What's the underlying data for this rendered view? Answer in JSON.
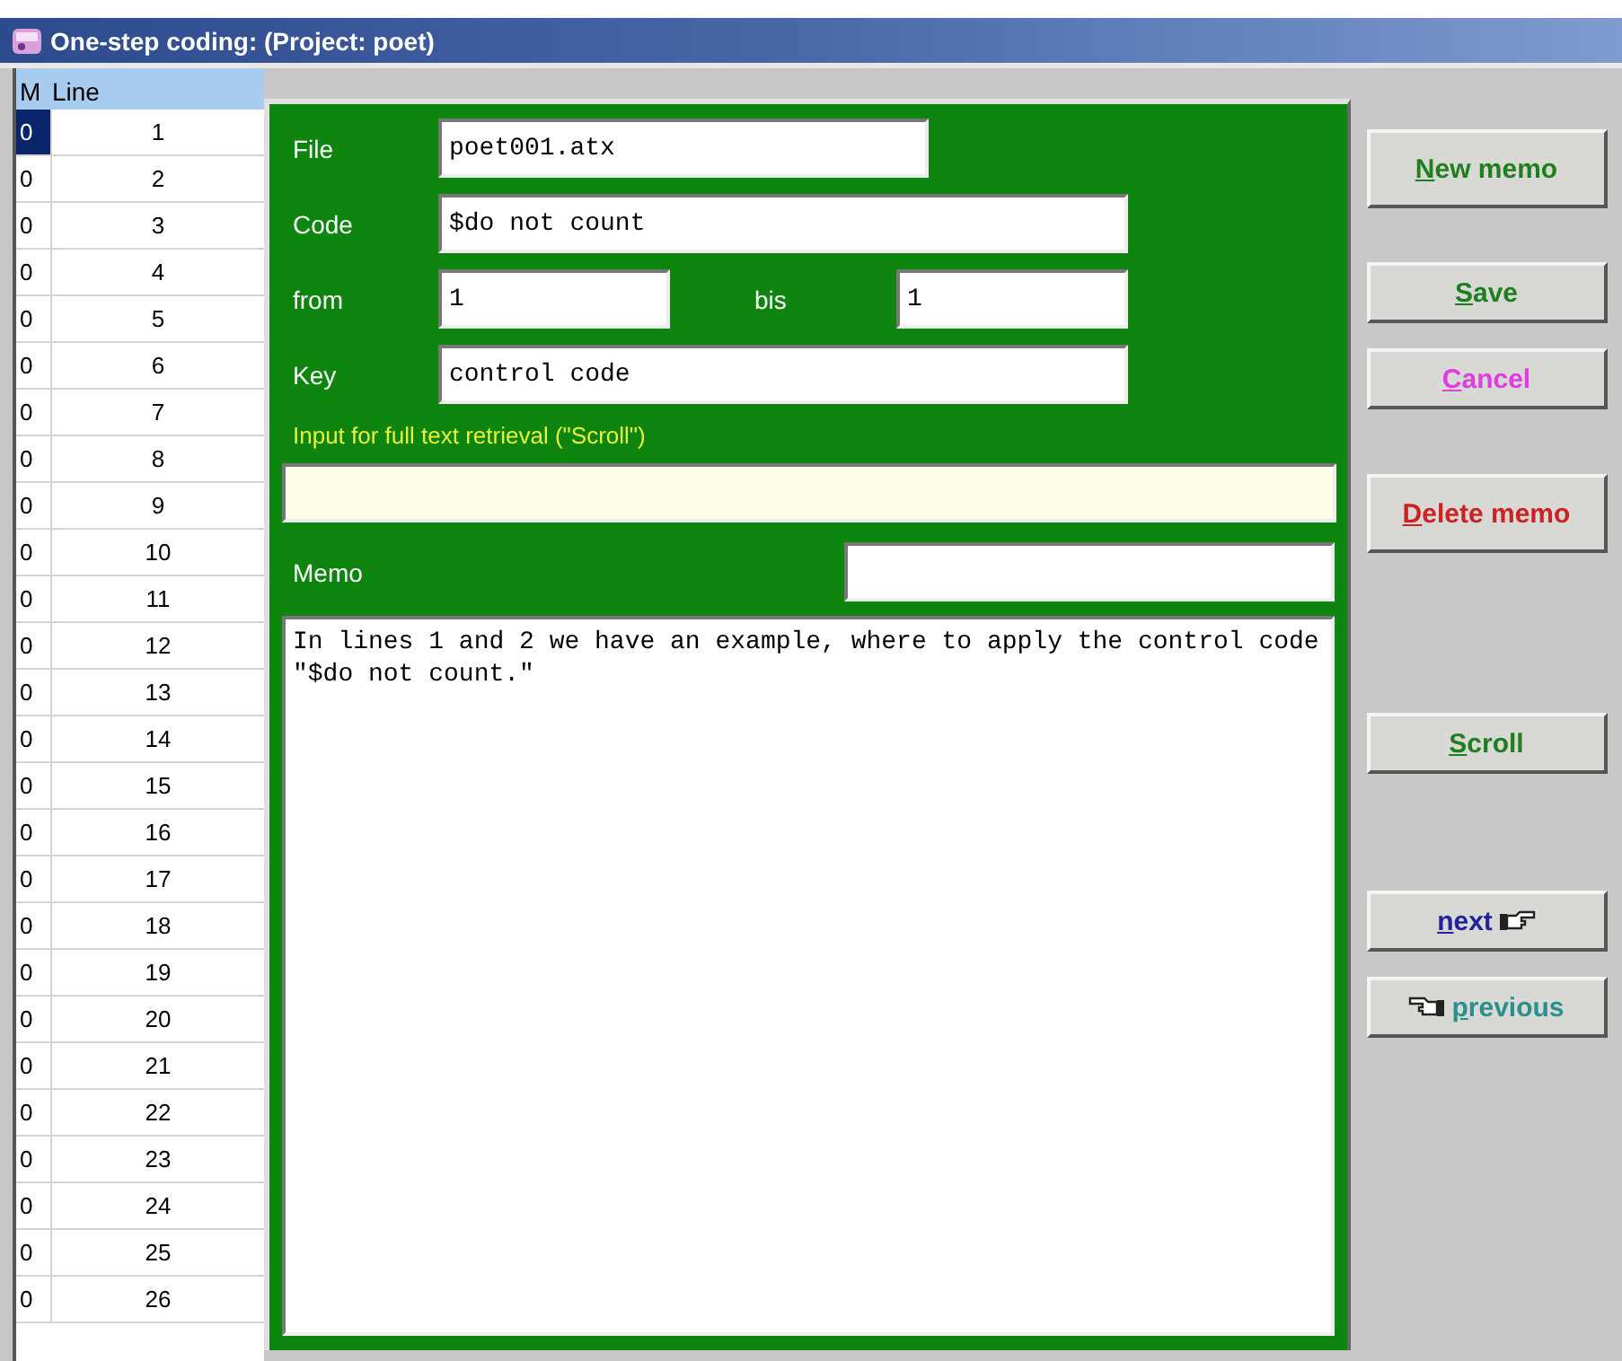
{
  "window": {
    "title": "One-step coding: (Project: poet)"
  },
  "table": {
    "columns": [
      "M",
      "Line"
    ],
    "rows": [
      {
        "m": "0",
        "line": "1",
        "selected": true
      },
      {
        "m": "0",
        "line": "2",
        "selected": false
      },
      {
        "m": "0",
        "line": "3",
        "selected": false
      },
      {
        "m": "0",
        "line": "4",
        "selected": false
      },
      {
        "m": "0",
        "line": "5",
        "selected": false
      },
      {
        "m": "0",
        "line": "6",
        "selected": false
      },
      {
        "m": "0",
        "line": "7",
        "selected": false
      },
      {
        "m": "0",
        "line": "8",
        "selected": false
      },
      {
        "m": "0",
        "line": "9",
        "selected": false
      },
      {
        "m": "0",
        "line": "10",
        "selected": false
      },
      {
        "m": "0",
        "line": "11",
        "selected": false
      },
      {
        "m": "0",
        "line": "12",
        "selected": false
      },
      {
        "m": "0",
        "line": "13",
        "selected": false
      },
      {
        "m": "0",
        "line": "14",
        "selected": false
      },
      {
        "m": "0",
        "line": "15",
        "selected": false
      },
      {
        "m": "0",
        "line": "16",
        "selected": false
      },
      {
        "m": "0",
        "line": "17",
        "selected": false
      },
      {
        "m": "0",
        "line": "18",
        "selected": false
      },
      {
        "m": "0",
        "line": "19",
        "selected": false
      },
      {
        "m": "0",
        "line": "20",
        "selected": false
      },
      {
        "m": "0",
        "line": "21",
        "selected": false
      },
      {
        "m": "0",
        "line": "22",
        "selected": false
      },
      {
        "m": "0",
        "line": "23",
        "selected": false
      },
      {
        "m": "0",
        "line": "24",
        "selected": false
      },
      {
        "m": "0",
        "line": "25",
        "selected": false
      },
      {
        "m": "0",
        "line": "26",
        "selected": false
      }
    ]
  },
  "dialog": {
    "file": {
      "label": "File",
      "value": "poet001.atx"
    },
    "code": {
      "label": "Code",
      "value": "$do not count"
    },
    "from": {
      "label": "from",
      "value": "1"
    },
    "bis": {
      "label": "bis",
      "value": "1"
    },
    "key": {
      "label": "Key",
      "value": "control code"
    },
    "retrieval": {
      "label": "Input for full text retrieval (\"Scroll\")"
    },
    "memo": {
      "label": "Memo"
    },
    "memo_text": "In lines 1 and 2 we have an example, where to apply the control code \"$do not count.\""
  },
  "button_groups": [
    [
      {
        "label": "New memo",
        "kind": "plain",
        "color": "#1f7f1f"
      }
    ],
    [
      {
        "label": "Save",
        "kind": "plain",
        "color": "#1f7f1f"
      },
      {
        "label": "Cancel",
        "kind": "plain",
        "color": "#e03ce0"
      }
    ],
    [
      {
        "label": "Delete memo",
        "kind": "plain",
        "color": "#cc2222"
      }
    ],
    [
      {
        "label": "Scroll",
        "kind": "plain",
        "color": "#1f7f1f"
      }
    ],
    [
      {
        "label": "next",
        "kind": "next",
        "color": "#22229a"
      },
      {
        "label": "previous",
        "kind": "previous",
        "color": "#2a8f8f"
      }
    ]
  ]
}
